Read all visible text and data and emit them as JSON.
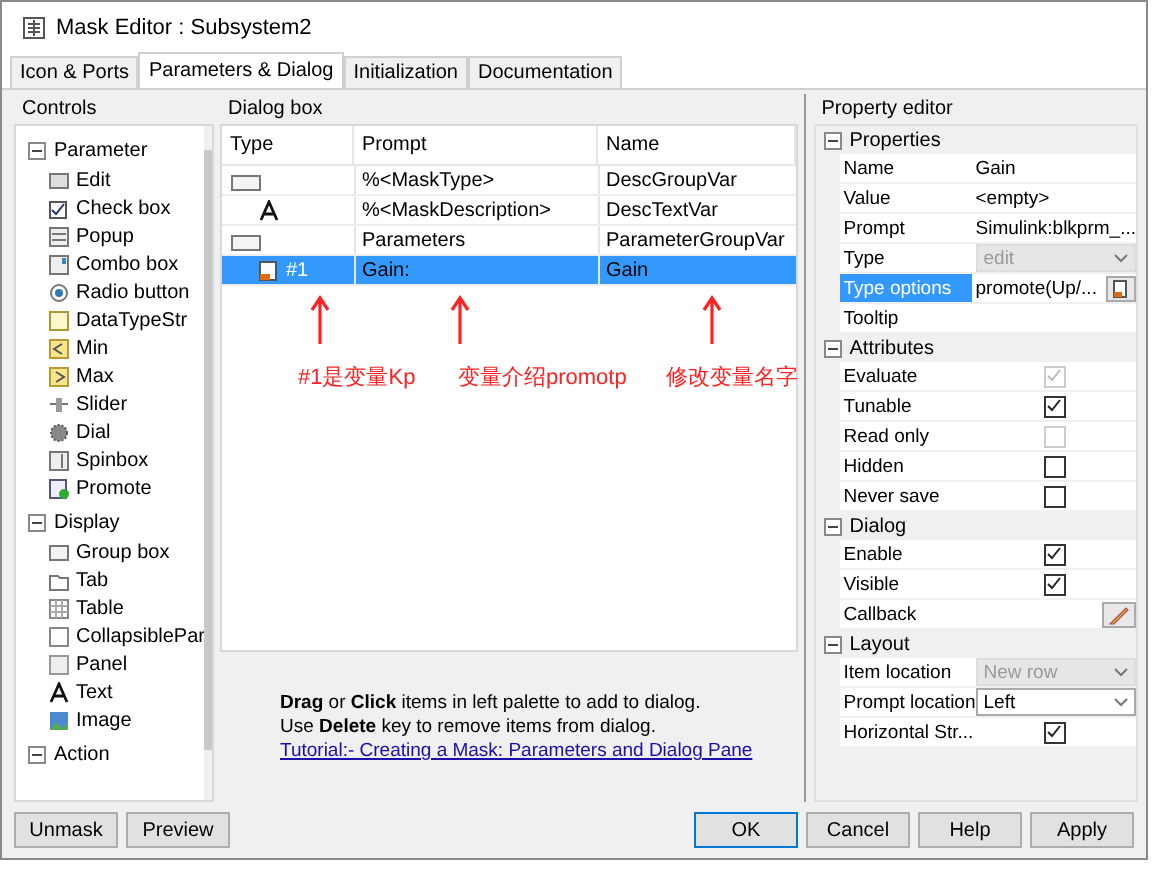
{
  "window": {
    "title": "Mask Editor : Subsystem2"
  },
  "tabs": [
    {
      "label": "Icon & Ports",
      "selected": false
    },
    {
      "label": "Parameters & Dialog",
      "selected": true
    },
    {
      "label": "Initialization",
      "selected": false
    },
    {
      "label": "Documentation",
      "selected": false
    }
  ],
  "controls": {
    "title": "Controls",
    "groups": [
      {
        "label": "Parameter",
        "expanded": true,
        "items": [
          {
            "label": "Edit",
            "kind": "edit"
          },
          {
            "label": "Check box",
            "kind": "checkbox"
          },
          {
            "label": "Popup",
            "kind": "popup"
          },
          {
            "label": "Combo box",
            "kind": "combo"
          },
          {
            "label": "Radio button",
            "kind": "radio"
          },
          {
            "label": "DataTypeStr",
            "kind": "datatype"
          },
          {
            "label": "Min",
            "kind": "min"
          },
          {
            "label": "Max",
            "kind": "max"
          },
          {
            "label": "Slider",
            "kind": "slider"
          },
          {
            "label": "Dial",
            "kind": "dial"
          },
          {
            "label": "Spinbox",
            "kind": "spinbox"
          },
          {
            "label": "Promote",
            "kind": "promote"
          }
        ]
      },
      {
        "label": "Display",
        "expanded": true,
        "items": [
          {
            "label": "Group box",
            "kind": "groupbox"
          },
          {
            "label": "Tab",
            "kind": "tab"
          },
          {
            "label": "Table",
            "kind": "table"
          },
          {
            "label": "CollapsiblePar",
            "kind": "collapsible"
          },
          {
            "label": "Panel",
            "kind": "panel"
          },
          {
            "label": "Text",
            "kind": "text"
          },
          {
            "label": "Image",
            "kind": "image"
          }
        ]
      },
      {
        "label": "Action",
        "expanded": true
      }
    ]
  },
  "dialog_box": {
    "title": "Dialog box",
    "columns": [
      "Type",
      "Prompt",
      "Name"
    ],
    "rows": [
      {
        "kind": "group",
        "prompt": "%<MaskType>",
        "name": "DescGroupVar",
        "selected": false,
        "children": [
          {
            "kind": "text",
            "prompt": "%<MaskDescription>",
            "name": "DescTextVar",
            "selected": false
          }
        ]
      },
      {
        "kind": "group",
        "prompt": "Parameters",
        "name": "ParameterGroupVar",
        "selected": false,
        "children": [
          {
            "kind": "edit",
            "type": "#1",
            "prompt": "Gain:",
            "name": "Gain",
            "selected": true
          }
        ]
      }
    ],
    "annotations": [
      "#1是变量Kp",
      "变量介绍promotp",
      "修改变量名字"
    ],
    "help": [
      "**Drag** or **Click** items in left palette to add to dialog.",
      "Use **Delete** key to remove items from dialog."
    ],
    "link": "Tutorial:- Creating a Mask: Parameters and Dialog Pane"
  },
  "property_editor": {
    "title": "Property editor",
    "sections": [
      {
        "label": "Properties",
        "expanded": true,
        "rows": [
          {
            "kind": "text",
            "label": "Name",
            "value": "Gain",
            "selected": false
          },
          {
            "kind": "text",
            "label": "Value",
            "value": "<empty>",
            "selected": false
          },
          {
            "kind": "text",
            "label": "Prompt",
            "value": "Simulink:blkprm_...",
            "selected": false
          },
          {
            "kind": "dropdown",
            "label": "Type",
            "value": "edit",
            "disabled": true,
            "selected": false
          },
          {
            "kind": "options",
            "label": "Type options",
            "value": "promote(Up/...",
            "selected": true
          },
          {
            "kind": "text",
            "label": "Tooltip",
            "value": "",
            "selected": false
          }
        ]
      },
      {
        "label": "Attributes",
        "expanded": true,
        "rows": [
          {
            "kind": "checkbox",
            "label": "Evaluate",
            "checked": true,
            "disabled": true,
            "selected": false
          },
          {
            "kind": "checkbox",
            "label": "Tunable",
            "checked": true,
            "disabled": false,
            "selected": false
          },
          {
            "kind": "checkbox",
            "label": "Read only",
            "checked": false,
            "disabled": true,
            "selected": false
          },
          {
            "kind": "checkbox",
            "label": "Hidden",
            "checked": false,
            "disabled": false,
            "selected": false
          },
          {
            "kind": "checkbox",
            "label": "Never save",
            "checked": false,
            "disabled": false,
            "selected": false
          }
        ]
      },
      {
        "label": "Dialog",
        "expanded": true,
        "rows": [
          {
            "kind": "checkbox",
            "label": "Enable",
            "checked": true,
            "disabled": false,
            "selected": false
          },
          {
            "kind": "checkbox",
            "label": "Visible",
            "checked": true,
            "disabled": false,
            "selected": false
          },
          {
            "kind": "callback",
            "label": "Callback",
            "selected": false
          }
        ]
      },
      {
        "label": "Layout",
        "expanded": true,
        "rows": [
          {
            "kind": "dropdown",
            "label": "Item location",
            "value": "New row",
            "disabled": true,
            "selected": false
          },
          {
            "kind": "dropdown",
            "label": "Prompt location",
            "value": "Left",
            "disabled": false,
            "selected": false
          },
          {
            "kind": "checkbox",
            "label": "Horizontal Str...",
            "checked": true,
            "disabled": false,
            "selected": false
          }
        ]
      }
    ]
  },
  "buttons_left": [
    {
      "label": "Unmask",
      "default": false
    },
    {
      "label": "Preview",
      "default": false
    }
  ],
  "buttons_right": [
    {
      "label": "OK",
      "default": true
    },
    {
      "label": "Cancel",
      "default": false
    },
    {
      "label": "Help",
      "default": false
    },
    {
      "label": "Apply",
      "default": false
    }
  ]
}
